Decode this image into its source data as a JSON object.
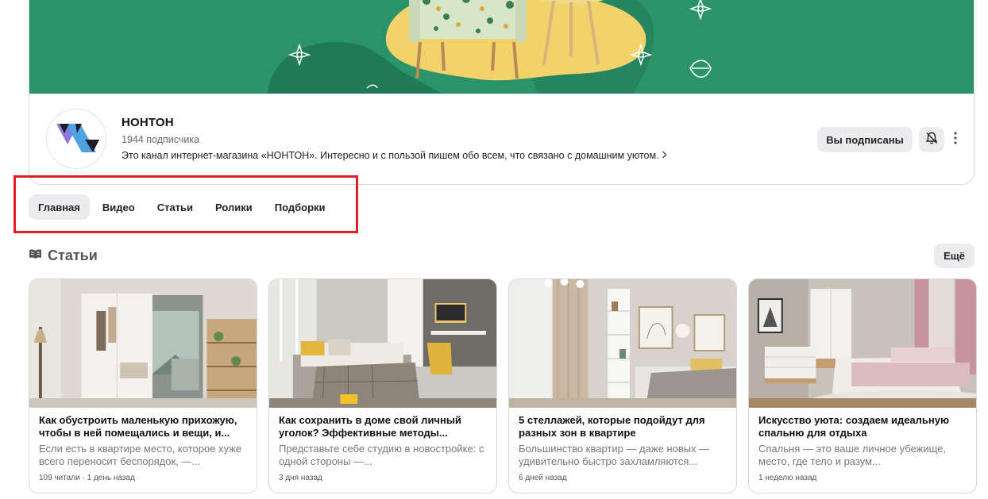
{
  "channel": {
    "name": "НОНТОН",
    "subscribers": "1944 подписчика",
    "description": "Это канал интернет-магазина «НОНТОН». Интересно и с пользой пишем обо всем, что связано с домашним уютом.",
    "subscribed_label": "Вы подписаны",
    "bell_icon": "bell-off-icon",
    "more_icon": "vertical-dots-icon"
  },
  "tabs": [
    {
      "label": "Главная",
      "active": true
    },
    {
      "label": "Видео",
      "active": false
    },
    {
      "label": "Статьи",
      "active": false
    },
    {
      "label": "Ролики",
      "active": false
    },
    {
      "label": "Подборки",
      "active": false
    }
  ],
  "section": {
    "title": "Статьи",
    "icon": "articles-icon",
    "more_label": "Ещё"
  },
  "articles": [
    {
      "title": "Как обустроить маленькую прихожую, чтобы в ней помещались и вещи, и...",
      "excerpt": "Если есть в квартире место, которое хуже всего переносит беспорядок, —...",
      "meta": "109 читали · 1 день назад"
    },
    {
      "title": "Как сохранить в доме свой личный уголок? Эффективные методы...",
      "excerpt": "Представьте себе студию в новостройке: с одной стороны —...",
      "meta": "3 дня назад"
    },
    {
      "title": "5 стеллажей, которые подойдут для разных зон в квартире",
      "excerpt": "Большинство квартир — даже новых — удивительно быстро захламляются...",
      "meta": "6 дней назад"
    },
    {
      "title": "Искусство уюта: создаем идеальную спальню для отдыха",
      "excerpt": "Спальня — это ваше личное убежище, место, где тело и разум...",
      "meta": "1 неделю назад"
    }
  ],
  "colors": {
    "banner_green": "#2a9468",
    "highlight_red": "#e21b25",
    "pill_gray": "#ececef"
  }
}
